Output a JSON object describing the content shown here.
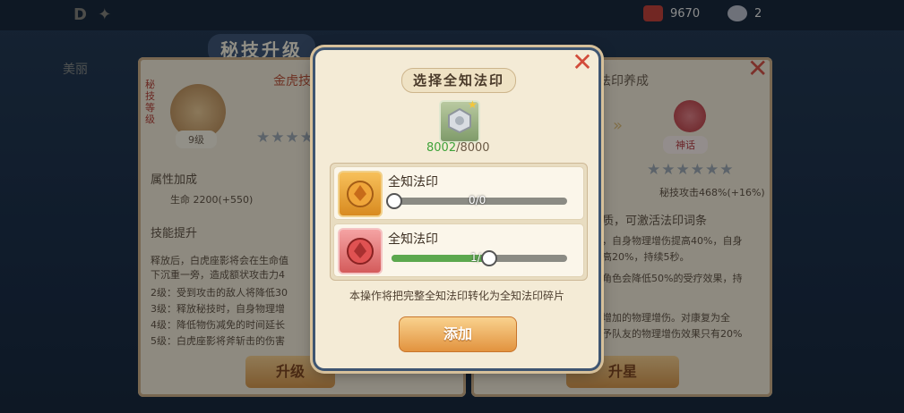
{
  "top": {
    "resources": [
      {
        "icon": "gem-icon",
        "value": "9670"
      },
      {
        "icon": "coin-icon",
        "value": "2"
      }
    ]
  },
  "background": {
    "panel_title": "秘技升级",
    "left_tabs": [
      "美丽",
      "",
      "",
      ""
    ],
    "left_panel": {
      "skill_name": "金虎技",
      "level_badge": "9级",
      "tag": "秘技等级",
      "attr_header": "属性加成",
      "attr_line": "生命 2200(+550)",
      "skill_header": "技能提升",
      "text_lines": [
        "释放后，白虎座影将会在生命值",
        "下沉重一旁，造成额状攻击力4",
        "2级：受到攻击的敌人将降低30",
        "3级：释放秘技时，自身物理增",
        "4级：降低物伤减免的时间延长",
        "5级：白虎座影将斧斩击的伤害"
      ],
      "upgrade_button": "升级"
    },
    "right_panel": {
      "title": "法印养成",
      "rank_badge": "神话",
      "attr_line": "秘技攻击468%(+16%)",
      "text_lines": [
        "质，可激活法印词条",
        "，自身物理增伤提高40%，自身",
        "高20%，持续5秒。",
        "角色会降低50%的受疗效果，持",
        "增加的物理增伤。对康复为全",
        "予队友的物理增伤效果只有20%"
      ],
      "star_button": "升星"
    }
  },
  "modal": {
    "title": "选择全知法印",
    "item_count_owned": "8002",
    "item_count_required": "/8000",
    "rows": [
      {
        "name": "全知法印",
        "slider_text": "0/0",
        "fill": 0.0,
        "color": "gold"
      },
      {
        "name": "全知法印",
        "slider_text": "1/",
        "fill": 0.55,
        "color": "red"
      }
    ],
    "note": "本操作将把完整全知法印转化为全知法印碎片",
    "add_button": "添加",
    "close_icon": "close-icon"
  },
  "colors": {
    "accent": "#e2933f",
    "close": "#d24b3a",
    "owned_count": "#3fa33a",
    "slider_fill": "#5ca84e"
  }
}
